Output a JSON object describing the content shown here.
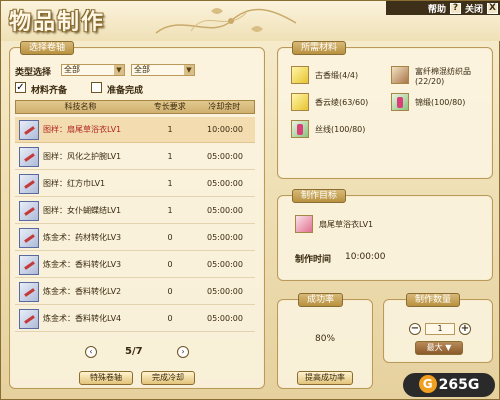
{
  "window": {
    "title": "物品制作",
    "help_label": "帮助",
    "help_icon": "?",
    "close_label": "关闭",
    "close_icon": "X"
  },
  "recipe_panel": {
    "tab": "选择卷轴",
    "type_label": "类型选择",
    "filter1": "全部",
    "filter2": "全部",
    "check_materials": {
      "label": "材料齐备",
      "checked": true
    },
    "check_ready": {
      "label": "准备完成",
      "checked": false
    },
    "columns": [
      "科技名称",
      "专长要求",
      "冷却余时"
    ],
    "rows": [
      {
        "name": "图样：扇尾草浴衣LV1",
        "req": "1",
        "cooldown": "10:00:00",
        "selected": true,
        "red": true
      },
      {
        "name": "图样：风化之护腕LV1",
        "req": "1",
        "cooldown": "05:00:00",
        "selected": false,
        "red": false
      },
      {
        "name": "图样：红方巾LV1",
        "req": "1",
        "cooldown": "05:00:00",
        "selected": false,
        "red": false
      },
      {
        "name": "图样：女仆蝴蝶结LV1",
        "req": "1",
        "cooldown": "05:00:00",
        "selected": false,
        "red": false
      },
      {
        "name": "炼金术：药材转化LV3",
        "req": "0",
        "cooldown": "05:00:00",
        "selected": false,
        "red": false
      },
      {
        "name": "炼金术：香料转化LV3",
        "req": "0",
        "cooldown": "05:00:00",
        "selected": false,
        "red": false
      },
      {
        "name": "炼金术：香料转化LV2",
        "req": "0",
        "cooldown": "05:00:00",
        "selected": false,
        "red": false
      },
      {
        "name": "炼金术：香料转化LV4",
        "req": "0",
        "cooldown": "05:00:00",
        "selected": false,
        "red": false
      }
    ],
    "page": "5/7",
    "special_button": "特殊卷轴",
    "finish_cd_button": "完成冷却"
  },
  "materials_panel": {
    "tab": "所需材料",
    "items": [
      {
        "name": "古香缎(4/4)",
        "icon": "yellow-cloth-icon"
      },
      {
        "name": "富纤棉混纺织品",
        "sub": "(22/20)",
        "icon": "brown-cloth-icon"
      },
      {
        "name": "香云绫(63/60)",
        "icon": "yellow-cloth-icon"
      },
      {
        "name": "锦缎(100/80)",
        "icon": "silk-icon"
      },
      {
        "name": "丝线(100/80)",
        "icon": "thread-icon"
      }
    ]
  },
  "target_panel": {
    "tab": "制作目标",
    "item_name": "扇尾草浴衣LV1",
    "time_label": "制作时间",
    "time_value": "10:00:00"
  },
  "success_panel": {
    "tab": "成功率",
    "value": "80%",
    "button": "提高成功率"
  },
  "quantity_panel": {
    "tab": "制作数量",
    "minus": "−",
    "value": "1",
    "plus": "+",
    "max_button": "最大"
  },
  "watermark": {
    "circle": "G",
    "text": "265G"
  },
  "colors": {
    "selected_row": "#f3ddb0",
    "red_text": "#b0251c",
    "tab": "#c8a35a"
  }
}
